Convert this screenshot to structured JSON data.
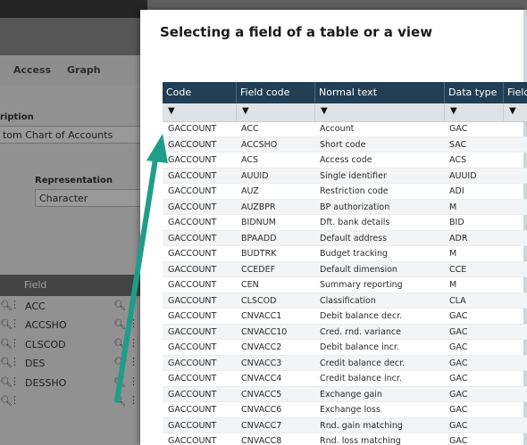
{
  "background": {
    "tabs": [
      "Access",
      "Graph"
    ],
    "description_label": "ription",
    "description_value": "tom Chart of Accounts",
    "representation_label": "Representation",
    "representation_value": "Character",
    "field_header": "Field",
    "field_rows": [
      "ACC",
      "ACCSHO",
      "CLSCOD",
      "DES",
      "DESSHO",
      ""
    ]
  },
  "dialog": {
    "title": "Selecting a field of a table or a view",
    "columns": [
      "Code",
      "Field code",
      "Normal text",
      "Data type",
      "Field"
    ],
    "filter_icon": "funnel-icon",
    "rows": [
      [
        "GACCOUNT",
        "ACC",
        "Account",
        "GAC"
      ],
      [
        "GACCOUNT",
        "ACCSHO",
        "Short code",
        "SAC"
      ],
      [
        "GACCOUNT",
        "ACS",
        "Access code",
        "ACS"
      ],
      [
        "GACCOUNT",
        "AUUID",
        "Single identifier",
        "AUUID"
      ],
      [
        "GACCOUNT",
        "AUZ",
        "Restriction code",
        "ADI"
      ],
      [
        "GACCOUNT",
        "AUZBPR",
        "BP authorization",
        "M"
      ],
      [
        "GACCOUNT",
        "BIDNUM",
        "Dft. bank details",
        "BID"
      ],
      [
        "GACCOUNT",
        "BPAADD",
        "Default address",
        "ADR"
      ],
      [
        "GACCOUNT",
        "BUDTRK",
        "Budget tracking",
        "M"
      ],
      [
        "GACCOUNT",
        "CCEDEF",
        "Default dimension",
        "CCE"
      ],
      [
        "GACCOUNT",
        "CEN",
        "Summary reporting",
        "M"
      ],
      [
        "GACCOUNT",
        "CLSCOD",
        "Classification",
        "CLA"
      ],
      [
        "GACCOUNT",
        "CNVACC1",
        "Debit balance decr.",
        "GAC"
      ],
      [
        "GACCOUNT",
        "CNVACC10",
        "Cred. rnd. variance",
        "GAC"
      ],
      [
        "GACCOUNT",
        "CNVACC2",
        "Debit balance incr.",
        "GAC"
      ],
      [
        "GACCOUNT",
        "CNVACC3",
        "Credit balance decr.",
        "GAC"
      ],
      [
        "GACCOUNT",
        "CNVACC4",
        "Credit balance incr.",
        "GAC"
      ],
      [
        "GACCOUNT",
        "CNVACC5",
        "Exchange gain",
        "GAC"
      ],
      [
        "GACCOUNT",
        "CNVACC6",
        "Exchange loss",
        "GAC"
      ],
      [
        "GACCOUNT",
        "CNVACC7",
        "Rnd. gain matching",
        "GAC"
      ],
      [
        "GACCOUNT",
        "CNVACC8",
        "Rnd. loss matching",
        "GAC"
      ]
    ]
  },
  "colors": {
    "header_bg": "#213e55",
    "arrow": "#1f9e87"
  }
}
